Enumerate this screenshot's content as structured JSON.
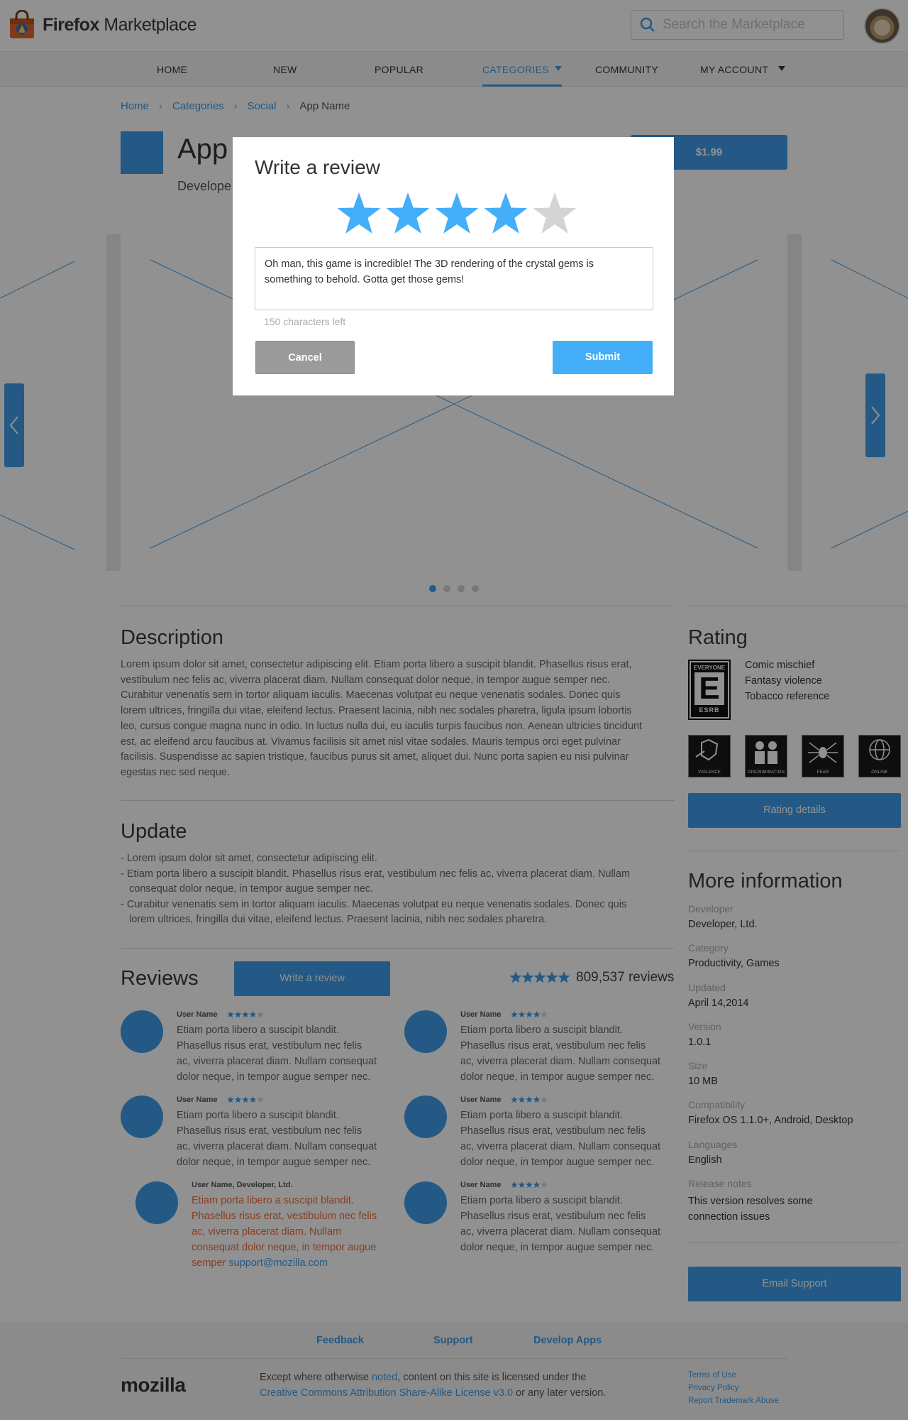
{
  "header": {
    "brand_bold": "Firefox",
    "brand_rest": " Marketplace",
    "search_placeholder": "Search the Marketplace"
  },
  "nav": {
    "items": [
      {
        "label": "HOME"
      },
      {
        "label": "NEW"
      },
      {
        "label": "POPULAR"
      },
      {
        "label": "CATEGORIES",
        "active": true
      },
      {
        "label": "COMMUNITY"
      },
      {
        "label": "MY ACCOUNT"
      }
    ]
  },
  "breadcrumb": [
    "Home",
    "Categories",
    "Social",
    "App Name"
  ],
  "app": {
    "name": "App",
    "developer": "Develope",
    "price": "$1.99"
  },
  "carousel": {
    "slide_count": 4,
    "active_slide": 1
  },
  "description": {
    "title": "Description",
    "lines": [
      "Lorem ipsum dolor sit amet, consectetur adipiscing elit. Etiam porta libero a suscipit blandit. Phasellus risus erat,",
      "vestibulum nec felis ac, viverra placerat diam. Nullam consequat dolor neque, in tempor augue semper nec.",
      "Curabitur venenatis sem in tortor aliquam iaculis. Maecenas volutpat eu neque venenatis sodales. Donec quis",
      "lorem ultrices, fringilla dui vitae, eleifend lectus. Praesent lacinia, nibh nec sodales pharetra, ligula ipsum lobortis",
      "leo, cursus congue magna nunc in odio. In luctus nulla dui, eu iaculis turpis faucibus non. Aenean ultricies tincidunt",
      "est, ac eleifend arcu faucibus at. Vivamus facilisis sit amet nisl vitae sodales. Mauris tempus orci eget pulvinar",
      "facilisis. Suspendisse ac sapien tristique, faucibus purus sit amet, aliquet dui. Nunc porta sapien eu nisi pulvinar",
      "egestas nec sed neque."
    ]
  },
  "update": {
    "title": "Update",
    "lines": [
      "- Lorem ipsum dolor sit amet, consectetur adipiscing elit.",
      "- Etiam porta libero a suscipit blandit. Phasellus risus erat, vestibulum nec felis ac, viverra placerat diam. Nullam",
      "  consequat dolor neque, in tempor augue semper nec.",
      "- Curabitur venenatis sem in tortor aliquam iaculis. Maecenas volutpat eu neque venenatis sodales. Donec quis",
      "  lorem ultrices, fringilla dui vitae, eleifend lectus. Praesent lacinia, nibh nec sodales pharetra."
    ]
  },
  "reviews": {
    "title": "Reviews",
    "write_label": "Write a review",
    "summary_rating": 5,
    "count_text": "809,537 reviews",
    "items": [
      {
        "user": "User Name",
        "rating": 4,
        "lines": [
          "Etiam porta libero a suscipit blandit.",
          "Phasellus risus erat, vestibulum nec felis",
          "ac, viverra placerat diam. Nullam consequat",
          "dolor neque, in tempor augue semper nec."
        ]
      },
      {
        "user": "User Name",
        "rating": 4,
        "lines": [
          "Etiam porta libero a suscipit blandit.",
          "Phasellus risus erat, vestibulum nec felis",
          "ac, viverra placerat diam. Nullam consequat",
          "dolor neque, in tempor augue semper nec."
        ]
      },
      {
        "user": "User Name",
        "rating": 4,
        "lines": [
          "Etiam porta libero a suscipit blandit.",
          "Phasellus risus erat, vestibulum nec felis",
          "ac, viverra placerat diam. Nullam consequat",
          "dolor neque, in tempor augue semper nec."
        ]
      },
      {
        "user": "User Name",
        "rating": 4,
        "lines": [
          "Etiam porta libero a suscipit blandit.",
          "Phasellus risus erat, vestibulum nec felis",
          "ac, viverra placerat diam. Nullam consequat",
          "dolor neque, in tempor augue semper nec."
        ]
      },
      {
        "user": "User Name",
        "rating": 4,
        "lines": [
          "Etiam porta libero a suscipit blandit.",
          "Phasellus risus erat, vestibulum nec felis",
          "ac, viverra placerat diam. Nullam consequat",
          "dolor neque, in tempor augue semper nec."
        ]
      }
    ],
    "dev_reply": {
      "user": "User Name, Developer, Ltd.",
      "lines": [
        "Etiam porta libero a suscipit blandit.",
        "Phasellus risus erat, vestibulum nec felis",
        "ac, viverra placerat diam. Nullam",
        "consequat dolor neque, in tempor augue"
      ],
      "last_prefix": "semper ",
      "email": "support@mozilla.com"
    }
  },
  "rating": {
    "title": "Rating",
    "esrb_top": "EVERYONE",
    "esrb_letter": "E",
    "esrb_bottom": "ESRB",
    "descriptors": [
      "Comic mischief",
      "Fantasy violence",
      "Tobacco reference"
    ],
    "icons": [
      {
        "label": "VIOLENCE"
      },
      {
        "label": "DISCRIMINATION"
      },
      {
        "label": "FEAR"
      },
      {
        "label": "ONLINE"
      }
    ],
    "details_label": "Rating details"
  },
  "more_info": {
    "title": "More information",
    "fields": [
      {
        "label": "Developer",
        "value": "Developer, Ltd."
      },
      {
        "label": "Category",
        "value": "Productivity, Games"
      },
      {
        "label": "Updated",
        "value": "April 14,2014"
      },
      {
        "label": "Version",
        "value": "1.0.1"
      },
      {
        "label": "Size",
        "value": "10 MB"
      },
      {
        "label": "Compatibility",
        "value": "Firefox OS 1.1.0+, Android, Desktop"
      },
      {
        "label": "Languages",
        "value": "English"
      },
      {
        "label": "Release notes",
        "value": "This version resolves some"
      }
    ],
    "release_notes_line2": "connection issues",
    "email_support_label": "Email Support"
  },
  "footer": {
    "links": [
      "Feedback",
      "Support",
      "Develop Apps"
    ],
    "mozilla": "mozilla",
    "license_a": "Except where otherwise ",
    "license_noted": "noted",
    "license_b": ", content on this site is licensed under the",
    "license_cc": "Creative Commons Attribution Share-Alike License v3.0",
    "license_c": " or any later version.",
    "small_links": [
      "Terms of Use",
      "Privacy Policy",
      "Report Trademark Abuse"
    ]
  },
  "modal": {
    "title": "Write a review",
    "rating": 4,
    "max_rating": 5,
    "text": "Oh man, this game is incredible! The 3D rendering of the crystal gems is something to behold. Gotta get those gems!",
    "chars_left": "150 characters left",
    "cancel_label": "Cancel",
    "submit_label": "Submit"
  },
  "colors": {
    "accent": "#3f9de8",
    "star_on": "#45aef8",
    "star_off": "#d4d4d4",
    "dev_reply": "#f06e3a",
    "cancel": "#9b9b9b"
  }
}
